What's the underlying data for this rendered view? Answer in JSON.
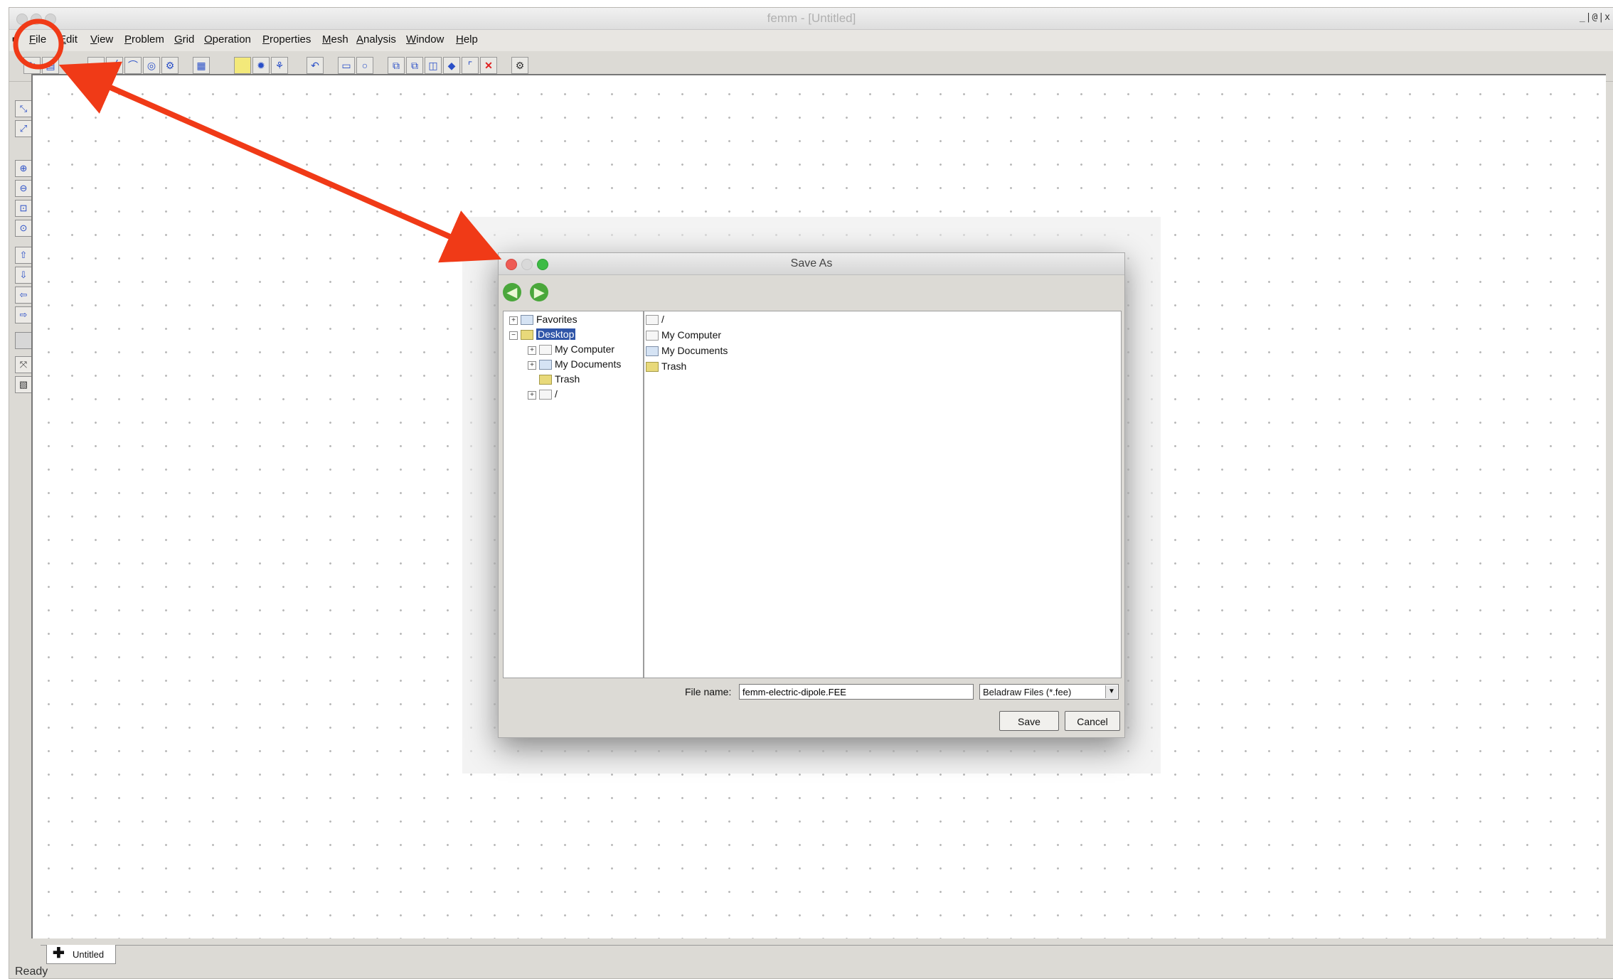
{
  "app": {
    "title": "femm - [Untitled]",
    "window_controls": "_|@|x"
  },
  "menu": [
    {
      "label": "File"
    },
    {
      "label": "Edit"
    },
    {
      "label": "View"
    },
    {
      "label": "Problem"
    },
    {
      "label": "Grid"
    },
    {
      "label": "Operation"
    },
    {
      "label": "Properties"
    },
    {
      "label": "Mesh"
    },
    {
      "label": "Analysis"
    },
    {
      "label": "Window"
    },
    {
      "label": "Help"
    }
  ],
  "toolbar_icons": [
    "open-icon",
    "save-icon",
    "node-icon",
    "segment-icon",
    "arc-icon",
    "block-label-icon",
    "group-icon",
    "props-icon",
    "block-icon",
    "mesh-icon",
    "run-icon",
    "undo-icon",
    "rect-icon",
    "circle-icon",
    "copy-icon",
    "move-icon",
    "scale-icon",
    "mirror-icon",
    "fillet-icon",
    "delete-icon",
    "settings-icon"
  ],
  "sidebar_icons": [
    "zoom-window-icon",
    "zoom-natural-icon",
    "zoom-in-icon",
    "zoom-out-icon",
    "zoom-fit-icon",
    "zoom-blank-icon",
    "pan-up-icon",
    "pan-down-icon",
    "pan-left-icon",
    "pan-right-icon",
    "grid-icon",
    "snap-icon",
    "mesh-show-icon"
  ],
  "document_tab": {
    "label": "Untitled"
  },
  "status": {
    "text": "Ready"
  },
  "dialog": {
    "title": "Save As",
    "tree": {
      "favorites": "Favorites",
      "desktop": "Desktop",
      "my_computer": "My Computer",
      "my_documents": "My Documents",
      "trash": "Trash",
      "root": "/"
    },
    "file_list": [
      {
        "name": "/"
      },
      {
        "name": "My Computer"
      },
      {
        "name": "My Documents"
      },
      {
        "name": "Trash"
      }
    ],
    "file_name_label": "File name:",
    "file_name_value": "femm-electric-dipole.FEE",
    "file_type_value": "Beladraw Files (*.fee)",
    "save_label": "Save",
    "cancel_label": "Cancel"
  },
  "colors": {
    "annotation_red": "#f03a17",
    "selection_blue": "#2f55a8",
    "mac_close": "#ee5b55",
    "mac_zoom": "#3dbb45"
  }
}
